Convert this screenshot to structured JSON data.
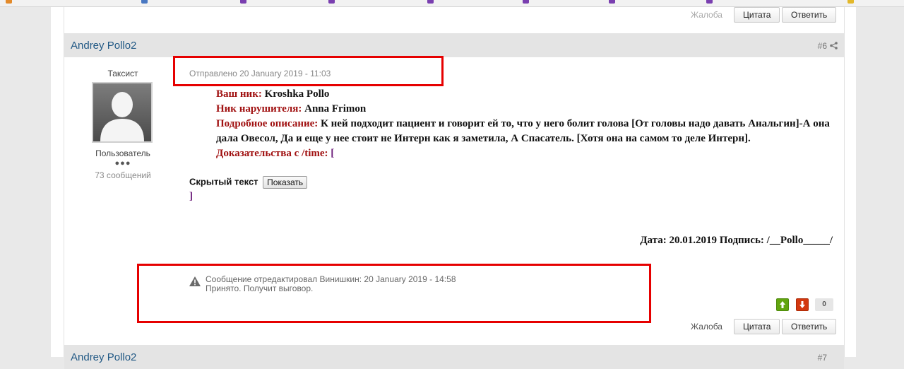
{
  "top_actions": {
    "report": "Жалоба",
    "quote": "Цитата",
    "reply": "Ответить"
  },
  "post": {
    "author": "Andrey Pollo2",
    "number": "#6",
    "user_title": "Таксист",
    "group": "Пользователь",
    "pips": "●●●",
    "post_count": "73 сообщений",
    "posted": "Отправлено 20 January 2019 - 11:03",
    "fields": {
      "nick_label": "Ваш ник:",
      "nick_value": "Kroshka Pollo",
      "violator_label": "Ник нарушителя:",
      "violator_value": "Anna Frimon",
      "desc_label": "Подробное описание:",
      "desc_value": "К ней подходит пациент и говорит ей то, что у него болит голова [От головы надо давать Анальгин]-А она дала Овесол, Да и еще у нее стоит не Интерн как я заметила, А Спасатель. [Хотя она на самом то деле Интерн].",
      "evidence_label": "Доказательства с /time:",
      "evidence_open": "["
    },
    "hidden_text_label": "Скрытый текст",
    "show_button": "Показать",
    "evidence_close": "]",
    "signature": "Дата: 20.01.2019 Подпись: /__Pollo_____/",
    "edit_note_line1": "Сообщение отредактировал Винишкин: 20 January 2019 - 14:58",
    "edit_note_line2": "Принято. Получит выговор.",
    "votes": "0",
    "actions": {
      "report": "Жалоба",
      "quote": "Цитата",
      "reply": "Ответить"
    }
  },
  "next_post": {
    "author": "Andrey Pollo2",
    "number": "#7"
  },
  "colors": {
    "accent_blue": "#225985",
    "label_red": "#a01010",
    "highlight_red": "#e60000",
    "vote_up": "#62a50f",
    "vote_down": "#d3380f"
  },
  "icons": [
    "share-icon",
    "warning-icon",
    "arrow-up-icon",
    "arrow-down-icon",
    "avatar-silhouette"
  ]
}
